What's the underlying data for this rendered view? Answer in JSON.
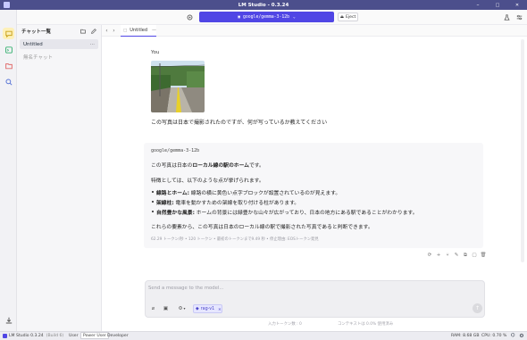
{
  "window": {
    "title": "LM Studio - 0.3.24",
    "min": "–",
    "max": "□",
    "close": "✕"
  },
  "topbar": {
    "model_label": "google/gemma-3-12b",
    "eject_label": "Eject"
  },
  "sidebar": {
    "header": "チャット一覧",
    "items": [
      {
        "label": "Untitled",
        "more": "···",
        "selected": true
      },
      {
        "label": "無名チャット",
        "selected": false
      }
    ]
  },
  "tab": {
    "label": "Untitled",
    "close": "—"
  },
  "user_msg": {
    "author": "You",
    "text": "この写真は日本で撮影されたのですが、何が写っているか教えてください"
  },
  "ai_msg": {
    "model": "google/gemma-3-12b",
    "line1_pre": "この写真は日本の",
    "line1_bold": "ローカル線の駅のホーム",
    "line1_post": "です。",
    "line2": "特徴としては、以下のような点が挙げられます。",
    "bullets": [
      {
        "bold": "線路とホーム:",
        "text": " 線路の横に黄色い点字ブロックが設置されているのが見えます。"
      },
      {
        "bold": "架線柱:",
        "text": " 電車を動かすための架線を取り付ける柱があります。"
      },
      {
        "bold": "自然豊かな風景:",
        "text": " ホームの背景には緑豊かな山々が広がっており、日本の地方にある駅であることがわかります。"
      }
    ],
    "conclusion": "これらの要素から、この写真は日本のローカル線の駅で撮影された写真であると判断できます。",
    "stats": "62.29 トークン/秒 • 120 トークン • 最初のトークンまで9.49 秒 • 停止理由: EOSトークン発見"
  },
  "input": {
    "placeholder": "Send a message to the model...",
    "rag_label": "rag-v1",
    "rag_remove": "✕"
  },
  "under_input": {
    "tokens": "入力トークン数 : 0",
    "context": "コンテキストは 0.0% 使用済み"
  },
  "status": {
    "app": "LM Studio 0.3.24",
    "build": "(Build 6)",
    "modes": [
      "User",
      "Power User",
      "Developer"
    ],
    "active_mode": "Power User",
    "ram": "RAM: 8.68 GB",
    "cpu": "CPU: 0.70 %"
  },
  "accent": "#5046e5"
}
